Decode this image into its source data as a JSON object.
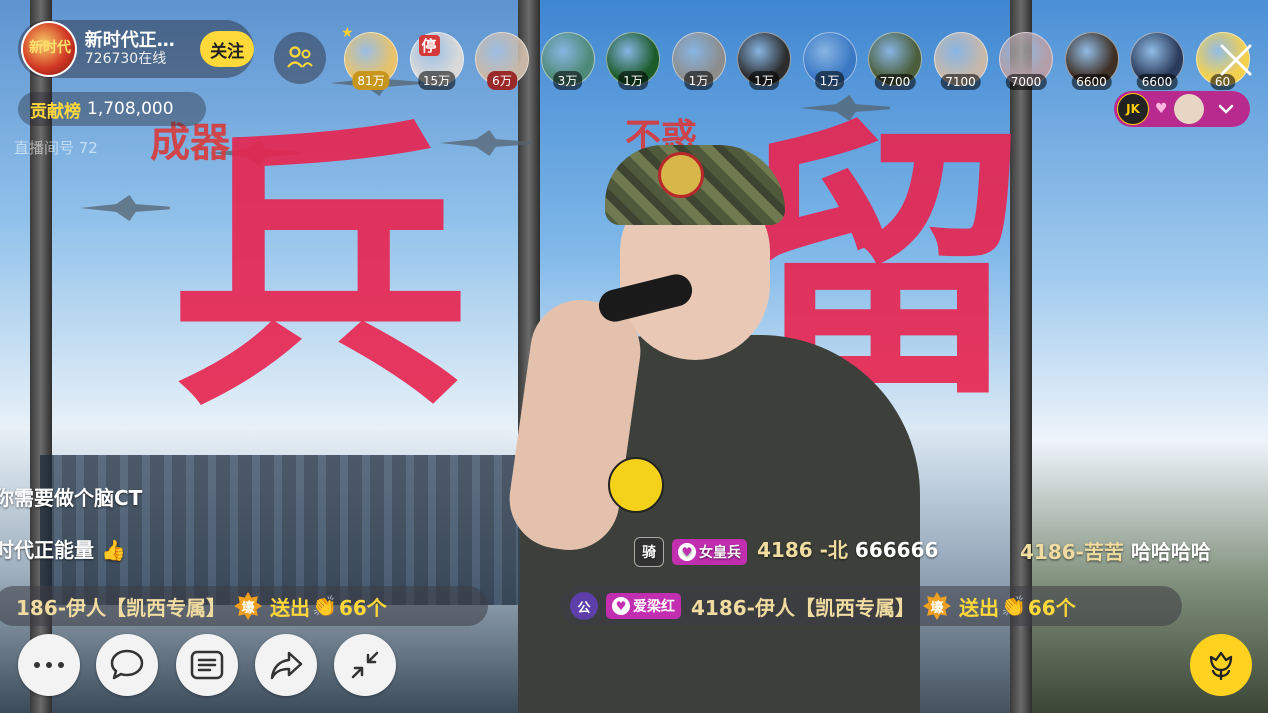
{
  "host": {
    "name": "新时代正…",
    "online": "726730在线",
    "follow_label": "关注",
    "avatar_text": "新时代"
  },
  "rank": {
    "label": "贡献榜",
    "value": "1,708,000"
  },
  "room_number": "直播间号 72",
  "viewers": [
    {
      "count": "81万",
      "color": "#e8c26a",
      "style": "gold",
      "crown": true
    },
    {
      "count": "15万",
      "color": "#d9d9d9",
      "style": "dark",
      "crown": false,
      "mark": "停"
    },
    {
      "count": "6万",
      "color": "#c9b7a6",
      "style": "red",
      "crown": false
    },
    {
      "count": "3万",
      "color": "#4f8a78",
      "style": "dark",
      "crown": false
    },
    {
      "count": "1万",
      "color": "#1c5b2a",
      "style": "dark",
      "crown": false
    },
    {
      "count": "1万",
      "color": "#8d8d8d",
      "style": "dark",
      "crown": false
    },
    {
      "count": "1万",
      "color": "#2d2d2d",
      "style": "dark",
      "crown": false
    },
    {
      "count": "1万",
      "color": "#3b78c4",
      "style": "dark",
      "crown": false
    },
    {
      "count": "7700",
      "color": "#4b5e3b",
      "style": "dark",
      "crown": false
    },
    {
      "count": "7100",
      "color": "#c7b8aa",
      "style": "dark",
      "crown": false
    },
    {
      "count": "7000",
      "color": "#b39da6",
      "style": "dark",
      "crown": false
    },
    {
      "count": "6600",
      "color": "#3e2f24",
      "style": "dark",
      "crown": false
    },
    {
      "count": "6600",
      "color": "#2a3a5a",
      "style": "dark",
      "crown": false
    },
    {
      "count": "60",
      "color": "#f4d04e",
      "style": "dark",
      "crown": false
    }
  ],
  "fans": {
    "logo_text": "JK"
  },
  "chat": [
    {
      "text": "你需要做个脑CT"
    },
    {
      "text": "时代正能量",
      "emoji": "👍"
    }
  ],
  "comment_main": {
    "ride_badge": "骑",
    "fan_badge": "女皇兵",
    "user": "4186 -北",
    "message": "666666"
  },
  "comment_side": {
    "user": "4186-苦苦",
    "message": "哈哈哈哈"
  },
  "gift_left": {
    "user": "186-伊人【凯西专属】",
    "badge": "壕",
    "sent": "送出",
    "gift": "👏",
    "count": "66个"
  },
  "gift_right": {
    "gong_badge": "公",
    "fan_badge": "爱梁红",
    "user": "4186-伊人【凯西专属】",
    "badge": "壕",
    "sent": "送出",
    "gift": "👏",
    "count": "66个"
  },
  "poster_text": {
    "left_big": "兵",
    "left_small": "成器",
    "middle_small": "不惑",
    "middle_big": "留"
  },
  "accent": "#ffd83a",
  "icons": [
    "more-icon",
    "chat-icon",
    "menu-icon",
    "share-icon",
    "collapse-icon",
    "flower-icon",
    "close-icon",
    "group-icon",
    "chevron-down-icon"
  ]
}
